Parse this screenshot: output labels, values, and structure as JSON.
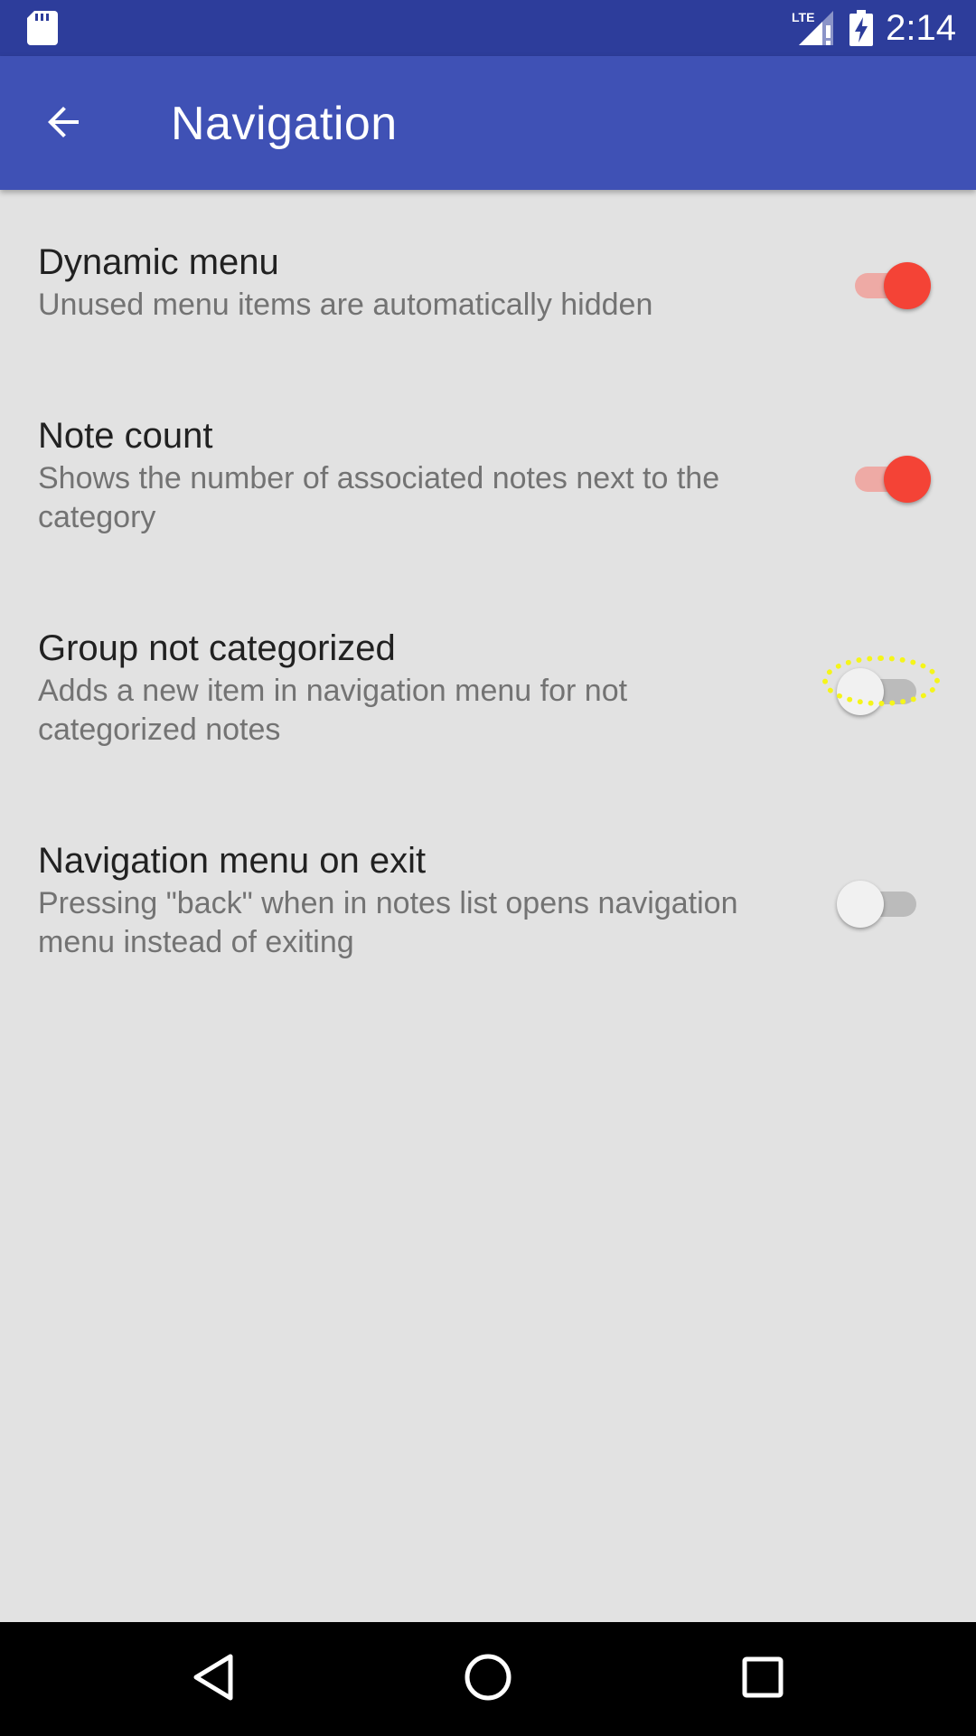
{
  "status_bar": {
    "time": "2:14",
    "network_label": "LTE",
    "icons": [
      "sd-card-icon",
      "lte-signal-icon",
      "battery-charging-icon"
    ]
  },
  "app_bar": {
    "title": "Navigation",
    "back_icon": "arrow-back-icon",
    "background_color": "#3f51b5"
  },
  "preferences": [
    {
      "title": "Dynamic menu",
      "summary": "Unused menu items are automatically hidden",
      "enabled": true
    },
    {
      "title": "Note count",
      "summary": "Shows the number of associated notes next to the category",
      "enabled": true
    },
    {
      "title": "Group not categorized",
      "summary": "Adds a new item in navigation menu for not categorized notes",
      "enabled": false,
      "focused": true
    },
    {
      "title": "Navigation menu on exit",
      "summary": "Pressing \"back\" when in notes list opens navigation menu instead of exiting",
      "enabled": false
    }
  ],
  "colors": {
    "status_bar": "#2d3d9b",
    "accent": "#f44336",
    "background": "#e2e2e2",
    "focus_highlight": "#f5f51a"
  },
  "nav_bar": {
    "buttons": [
      "back-triangle-icon",
      "home-circle-icon",
      "recents-square-icon"
    ]
  }
}
